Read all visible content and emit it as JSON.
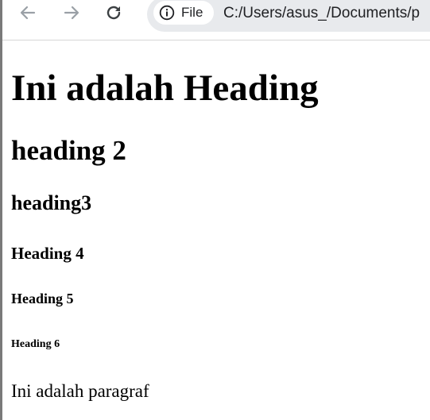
{
  "browser": {
    "site_chip_label": "File",
    "address": "C:/Users/asus_/Documents/p",
    "icons": {
      "back": "arrow-left-icon",
      "forward": "arrow-right-icon",
      "reload": "reload-icon",
      "site_info": "info-icon"
    },
    "colors": {
      "omnibox_bg": "#e8eaed",
      "disabled_nav": "#9aa0a6"
    }
  },
  "page": {
    "heading1": "Ini adalah Heading",
    "heading2": "heading 2",
    "heading3": "heading3",
    "heading4": "Heading 4",
    "heading5": "Heading 5",
    "heading6": "Heading 6",
    "paragraph": "Ini adalah paragraf"
  }
}
